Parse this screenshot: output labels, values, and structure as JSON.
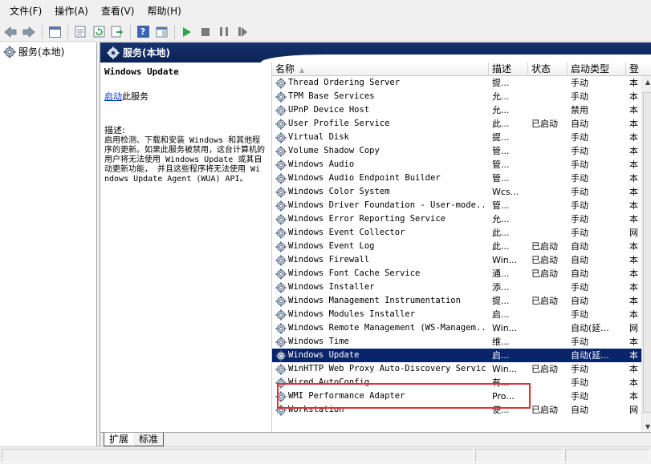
{
  "menu": {
    "items": [
      "文件(F)",
      "操作(A)",
      "查看(V)",
      "帮助(H)"
    ]
  },
  "toolbar": {
    "buttons": [
      "back-arrow-icon",
      "forward-arrow-icon",
      "console-tree-icon",
      "properties-icon",
      "refresh-icon",
      "export-icon",
      "help-icon",
      "show-hide-icon",
      "start-icon",
      "stop-icon",
      "pause-icon",
      "resume-icon"
    ],
    "help_glyph": "?"
  },
  "tree": {
    "root_label": "服务(本地)"
  },
  "pane": {
    "title": "服务(本地)"
  },
  "description": {
    "service_name": "Windows Update",
    "action_link": "启动",
    "action_suffix": "此服务",
    "label": "描述:",
    "text": "启用检测、下载和安装 Windows 和其他程序的更新。如果此服务被禁用，这台计算机的用户将无法使用 Windows Update 或其自动更新功能， 并且这些程序将无法使用 Windows Update Agent (WUA) API。"
  },
  "columns": {
    "name": "名称",
    "desc": "描述",
    "status": "状态",
    "startup": "启动类型",
    "logon": "登"
  },
  "services": [
    {
      "name": "Thread Ordering Server",
      "desc": "提...",
      "status": "",
      "startup": "手动",
      "logon": "本"
    },
    {
      "name": "TPM Base Services",
      "desc": "允...",
      "status": "",
      "startup": "手动",
      "logon": "本"
    },
    {
      "name": "UPnP Device Host",
      "desc": "允...",
      "status": "",
      "startup": "禁用",
      "logon": "本"
    },
    {
      "name": "User Profile Service",
      "desc": "此...",
      "status": "已启动",
      "startup": "自动",
      "logon": "本"
    },
    {
      "name": "Virtual Disk",
      "desc": "提...",
      "status": "",
      "startup": "手动",
      "logon": "本"
    },
    {
      "name": "Volume Shadow Copy",
      "desc": "管...",
      "status": "",
      "startup": "手动",
      "logon": "本"
    },
    {
      "name": "Windows Audio",
      "desc": "管...",
      "status": "",
      "startup": "手动",
      "logon": "本"
    },
    {
      "name": "Windows Audio Endpoint Builder",
      "desc": "管...",
      "status": "",
      "startup": "手动",
      "logon": "本"
    },
    {
      "name": "Windows Color System",
      "desc": "Wcs...",
      "status": "",
      "startup": "手动",
      "logon": "本"
    },
    {
      "name": "Windows Driver Foundation - User-mode...",
      "desc": "管...",
      "status": "",
      "startup": "手动",
      "logon": "本"
    },
    {
      "name": "Windows Error Reporting Service",
      "desc": "允...",
      "status": "",
      "startup": "手动",
      "logon": "本"
    },
    {
      "name": "Windows Event Collector",
      "desc": "此...",
      "status": "",
      "startup": "手动",
      "logon": "网"
    },
    {
      "name": "Windows Event Log",
      "desc": "此...",
      "status": "已启动",
      "startup": "自动",
      "logon": "本"
    },
    {
      "name": "Windows Firewall",
      "desc": "Win...",
      "status": "已启动",
      "startup": "自动",
      "logon": "本"
    },
    {
      "name": "Windows Font Cache Service",
      "desc": "通...",
      "status": "已启动",
      "startup": "自动",
      "logon": "本"
    },
    {
      "name": "Windows Installer",
      "desc": "添...",
      "status": "",
      "startup": "手动",
      "logon": "本"
    },
    {
      "name": "Windows Management Instrumentation",
      "desc": "提...",
      "status": "已启动",
      "startup": "自动",
      "logon": "本"
    },
    {
      "name": "Windows Modules Installer",
      "desc": "启...",
      "status": "",
      "startup": "手动",
      "logon": "本"
    },
    {
      "name": "Windows Remote Management (WS-Managem...",
      "desc": "Win...",
      "status": "",
      "startup": "自动(延...",
      "logon": "网"
    },
    {
      "name": "Windows Time",
      "desc": "维...",
      "status": "",
      "startup": "手动",
      "logon": "本"
    },
    {
      "name": "Windows Update",
      "desc": "启...",
      "status": "",
      "startup": "自动(延...",
      "logon": "本",
      "selected": true
    },
    {
      "name": "WinHTTP Web Proxy Auto-Discovery Service",
      "desc": "Win...",
      "status": "已启动",
      "startup": "手动",
      "logon": "本"
    },
    {
      "name": "Wired AutoConfig",
      "desc": "有...",
      "status": "",
      "startup": "手动",
      "logon": "本"
    },
    {
      "name": "WMI Performance Adapter",
      "desc": "Pro...",
      "status": "",
      "startup": "手动",
      "logon": "本"
    },
    {
      "name": "Workstation",
      "desc": "使...",
      "status": "已启动",
      "startup": "自动",
      "logon": "网"
    }
  ],
  "tabs": [
    "扩展",
    "标准"
  ],
  "colors": {
    "header_bg": "#0b2357",
    "selected_row": "#0a246a",
    "highlight_box": "#e53030",
    "link": "#0033cc"
  }
}
